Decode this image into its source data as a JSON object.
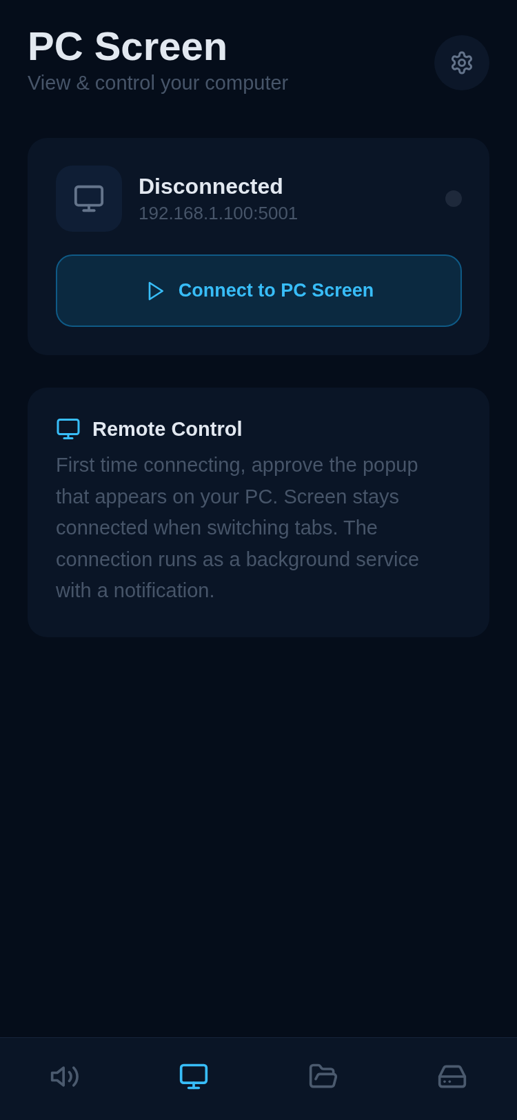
{
  "header": {
    "title": "PC Screen",
    "subtitle": "View & control your computer"
  },
  "connection": {
    "status": "Disconnected",
    "address": "192.168.1.100:5001",
    "connected": false,
    "button": "Connect to PC Screen"
  },
  "info": {
    "title": "Remote Control",
    "text": "First time connecting, approve the popup that appears on your PC. Screen stays connected when switching tabs. The connection runs as a background service with a notification."
  },
  "bottom_nav": [
    {
      "kind": "speaker",
      "selected": false
    },
    {
      "kind": "monitor",
      "selected": true
    },
    {
      "kind": "folder",
      "selected": false
    },
    {
      "kind": "drive",
      "selected": false
    }
  ]
}
